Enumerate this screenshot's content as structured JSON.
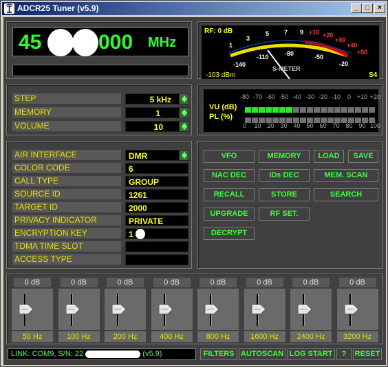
{
  "window": {
    "title": "ADCR25 Tuner (v5.9)",
    "min": "_",
    "max": "□",
    "close": "×"
  },
  "freq": {
    "digits_left": "45",
    "digits_right": "000",
    "unit": "MHz"
  },
  "smeter": {
    "rf": "RF: 0 dB",
    "dbm": "-103 dBm",
    "sval": "S4",
    "name": "S-METER",
    "upper_scale": [
      "1",
      "3",
      "5",
      "7",
      "9",
      "+10",
      "+20",
      "+30",
      "+40",
      "+50"
    ],
    "lower_scale": [
      "-140",
      "-110",
      "-80",
      "-50",
      "-20"
    ]
  },
  "tuning": {
    "step_label": "STEP",
    "step_value": "5 kHz",
    "memory_label": "MEMORY",
    "memory_value": "1",
    "volume_label": "VOLUME",
    "volume_value": "10"
  },
  "vu": {
    "top_scale": [
      "-80",
      "-70",
      "-60",
      "-50",
      "-40",
      "-30",
      "-20",
      "-10",
      "0",
      "+10",
      "+20"
    ],
    "bottom_scale": [
      "0",
      "10",
      "20",
      "30",
      "40",
      "50",
      "60",
      "70",
      "80",
      "90",
      "100"
    ],
    "vu_label": "VU (dB)",
    "pl_label": "PL (%)",
    "vu_level": 0.35,
    "pl_level": 0
  },
  "info": [
    {
      "label": "AIR INTERFACE",
      "value": "DMR"
    },
    {
      "label": "COLOR CODE",
      "value": "6"
    },
    {
      "label": "CALL TYPE",
      "value": "GROUP"
    },
    {
      "label": "SOURCE ID",
      "value": "1261"
    },
    {
      "label": "TARGET ID",
      "value": "2000"
    },
    {
      "label": "PRIVACY INDICATOR",
      "value": "PRIVATE"
    },
    {
      "label": "ENCRYPTION KEY",
      "value": "1"
    },
    {
      "label": "TDMA TIME SLOT",
      "value": ""
    },
    {
      "label": "ACCESS TYPE",
      "value": ""
    }
  ],
  "buttons": {
    "vfo": "VFO",
    "memory": "MEMORY",
    "load": "LOAD",
    "save": "SAVE",
    "nac_dec": "NAC DEC",
    "ids_dec": "IDs DEC",
    "mem_scan": "MEM. SCAN",
    "recall": "RECALL",
    "store": "STORE",
    "search": "SEARCH",
    "upgrade": "UPGRADE",
    "rf_set": "RF SET.",
    "decrypt": "DECRYPT"
  },
  "equalizer": [
    {
      "db": "0 dB",
      "hz": "50 Hz"
    },
    {
      "db": "0 dB",
      "hz": "100 Hz"
    },
    {
      "db": "0 dB",
      "hz": "200 Hz"
    },
    {
      "db": "0 dB",
      "hz": "400 Hz"
    },
    {
      "db": "0 dB",
      "hz": "800 Hz"
    },
    {
      "db": "0 dB",
      "hz": "1600 Hz"
    },
    {
      "db": "0 dB",
      "hz": "2400 Hz"
    },
    {
      "db": "0 dB",
      "hz": "3200 Hz"
    }
  ],
  "status": {
    "link": "LINK: COM9,  S/N: 22",
    "version": "(v5.9)",
    "filters": "FILTERS",
    "autoscan": "AUTOSCAN",
    "log_start": "LOG START",
    "help": "?",
    "reset": "RESET"
  }
}
